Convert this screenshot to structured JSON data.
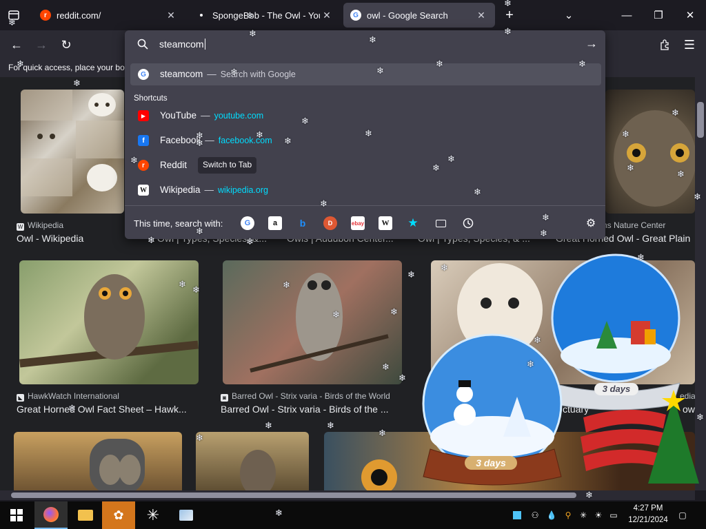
{
  "tabs": [
    {
      "title": "reddit.com/",
      "favicon": "reddit-icon",
      "color": "#ff4500",
      "active": false
    },
    {
      "title": "SpongeBob - The Owl - YouTube",
      "favicon": "audio-dot-icon",
      "color": "#fbfbfe",
      "active": false
    },
    {
      "title": "owl - Google Search",
      "favicon": "google-icon",
      "color": "#4285f4",
      "active": true
    }
  ],
  "urlbar": {
    "value": "steamcom",
    "top_suggestion": {
      "text": "steamcom",
      "action": "Search with Google"
    },
    "shortcuts_label": "Shortcuts",
    "shortcuts": [
      {
        "name": "YouTube",
        "url": "youtube.com",
        "icon": "youtube-icon",
        "color": "#ff0000"
      },
      {
        "name": "Facebook",
        "url": "facebook.com",
        "icon": "facebook-icon",
        "color": "#1877f2"
      },
      {
        "name": "Reddit",
        "switch_label": "Switch to Tab",
        "icon": "reddit-icon",
        "color": "#ff4500"
      },
      {
        "name": "Wikipedia",
        "url": "wikipedia.org",
        "icon": "wikipedia-icon",
        "color": "#ffffff"
      }
    ],
    "search_with_label": "This time, search with:",
    "engines": [
      "google-icon",
      "amazon-icon",
      "bing-icon",
      "duckduckgo-icon",
      "ebay-icon",
      "wikipedia-icon",
      "bookmarks-star-icon",
      "tabs-icon",
      "history-icon"
    ]
  },
  "bookmarks_hint": "For quick access, place your bookmarks here on the bookmarks toolbar.",
  "results": {
    "row1": [
      {
        "source": "Wikipedia",
        "title": "Owl - Wikipedia"
      },
      {
        "source": "",
        "title": "Owl | Types, Species, &..."
      },
      {
        "source": "",
        "title": "Owls | Audubon Center..."
      },
      {
        "source": "",
        "title": "Owl | Types, Species, & ..."
      },
      {
        "source": "ns Nature Center",
        "title": "Great Horned Owl - Great Plain"
      }
    ],
    "row2": [
      {
        "source": "HawkWatch International",
        "title": "Great Horned Owl Fact Sheet – Hawk..."
      },
      {
        "source": "Barred Owl - Strix varia - Birds of the World",
        "title": "Barred Owl - Strix varia - Birds of the ..."
      },
      {
        "source": "",
        "title": "ctuary"
      },
      {
        "source": "edia",
        "title": "ow"
      }
    ]
  },
  "globes": [
    {
      "label": "3 days"
    },
    {
      "label": "3 days"
    }
  ],
  "taskbar": {
    "time": "4:27 PM",
    "date": "12/21/2024"
  }
}
